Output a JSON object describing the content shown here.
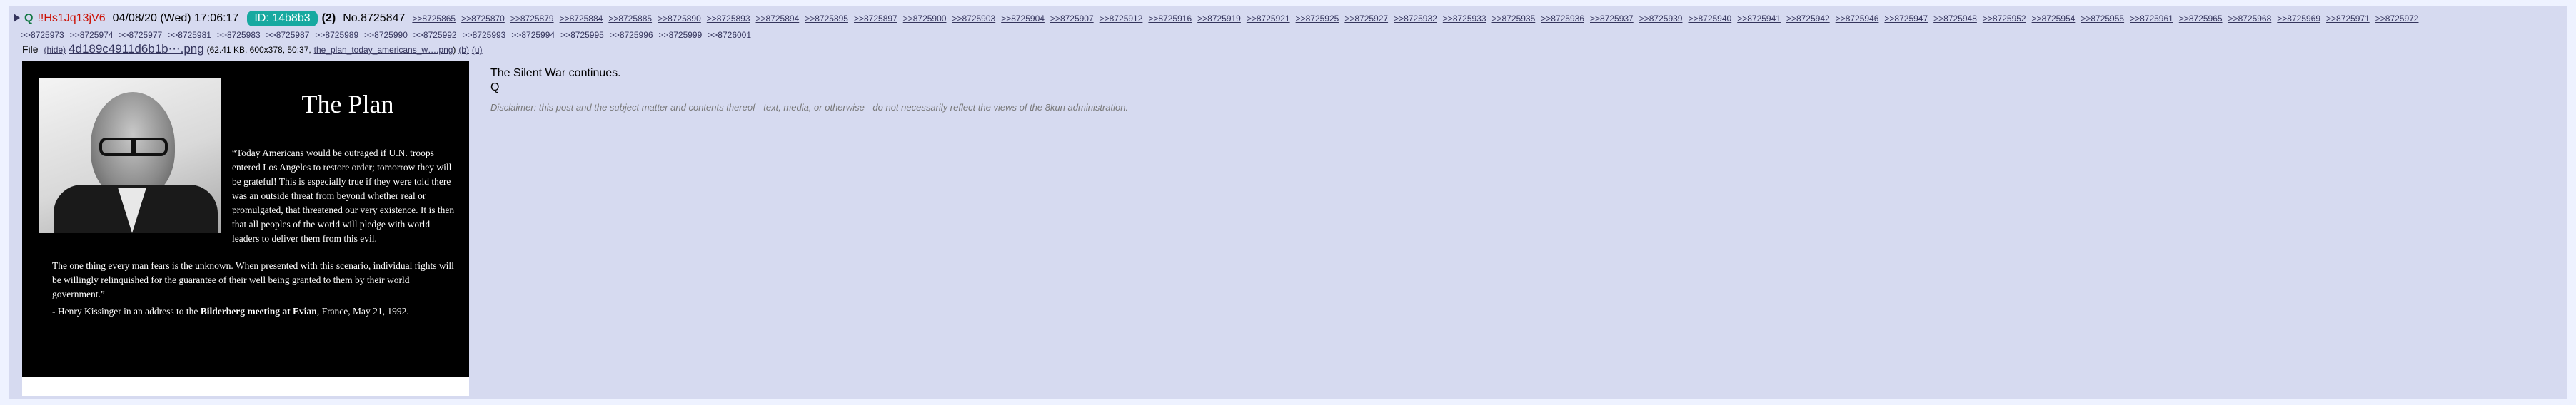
{
  "post": {
    "qflag": "Q",
    "tripcode": "!!Hs1Jq13jV6",
    "datetime": "04/08/20 (Wed) 17:06:17",
    "poster_id": "ID: 14b8b3",
    "id_count": "(2)",
    "post_number": "No.8725847",
    "backlinks_row1": [
      ">>8725865",
      ">>8725870",
      ">>8725879",
      ">>8725884",
      ">>8725885",
      ">>8725890",
      ">>8725893",
      ">>8725894",
      ">>8725895",
      ">>8725897",
      ">>8725900",
      ">>8725903",
      ">>8725904",
      ">>8725907",
      ">>8725912",
      ">>8725916",
      ">>8725919",
      ">>8725921",
      ">>8725925",
      ">>8725927",
      ">>8725932",
      ">>8725933",
      ">>8725935",
      ">>8725936",
      ">>8725937",
      ">>8725939",
      ">>8725940",
      ">>8725941",
      ">>8725942",
      ">>8725946",
      ">>8725947",
      ">>8725948",
      ">>8725952",
      ">>8725954",
      ">>8725955",
      ">>8725961",
      ">>8725965",
      ">>8725968",
      ">>8725969",
      ">>8725971",
      ">>8725972"
    ],
    "backlinks_row2": [
      ">>8725973",
      ">>8725974",
      ">>8725977",
      ">>8725981",
      ">>8725983",
      ">>8725987",
      ">>8725989",
      ">>8725990",
      ">>8725992",
      ">>8725993",
      ">>8725994",
      ">>8725995",
      ">>8725996",
      ">>8725999",
      ">>8726001"
    ]
  },
  "file": {
    "label": "File",
    "hide": "(hide)",
    "filename": "4d189c4911d6b1b⋯.png",
    "meta": "(62.41 KB, 600x378, 50:37,",
    "original_name": "the_plan_today_americans_w….png",
    "meta_end": ")",
    "b": "(b)",
    "u": "(u)"
  },
  "image": {
    "title": "The Plan",
    "quote": "“Today Americans would be outraged if U.N. troops entered Los Angeles to restore order; tomorrow they will be grateful! This is especially true if they were told there was an outside threat from beyond whether real or promulgated, that threatened our very existence. It is then that all peoples of the world will pledge with world leaders to deliver them from this evil.",
    "para": "The one thing every man fears is the unknown. When presented with this scenario, individual rights will be willingly relinquished for the guarantee of their well being granted to them by their world government.”",
    "attrib_prefix": "- Henry Kissinger in an address to the",
    "attrib_bold": "Bilderberg meeting at Evian",
    "attrib_suffix": ", France, May 21, 1992."
  },
  "body": {
    "line1": "The Silent War continues.",
    "line2": "Q",
    "disclaimer": "Disclaimer: this post and the subject matter and contents thereof - text, media, or otherwise - do not necessarily reflect the views of the 8kun administration."
  },
  "colors": {
    "background": "#eef2ff",
    "post_background": "#d6daf0",
    "tripcode": "#cc1105",
    "qflag": "#117743",
    "poster_id_bg": "#17a9a0",
    "link": "#34345c"
  }
}
